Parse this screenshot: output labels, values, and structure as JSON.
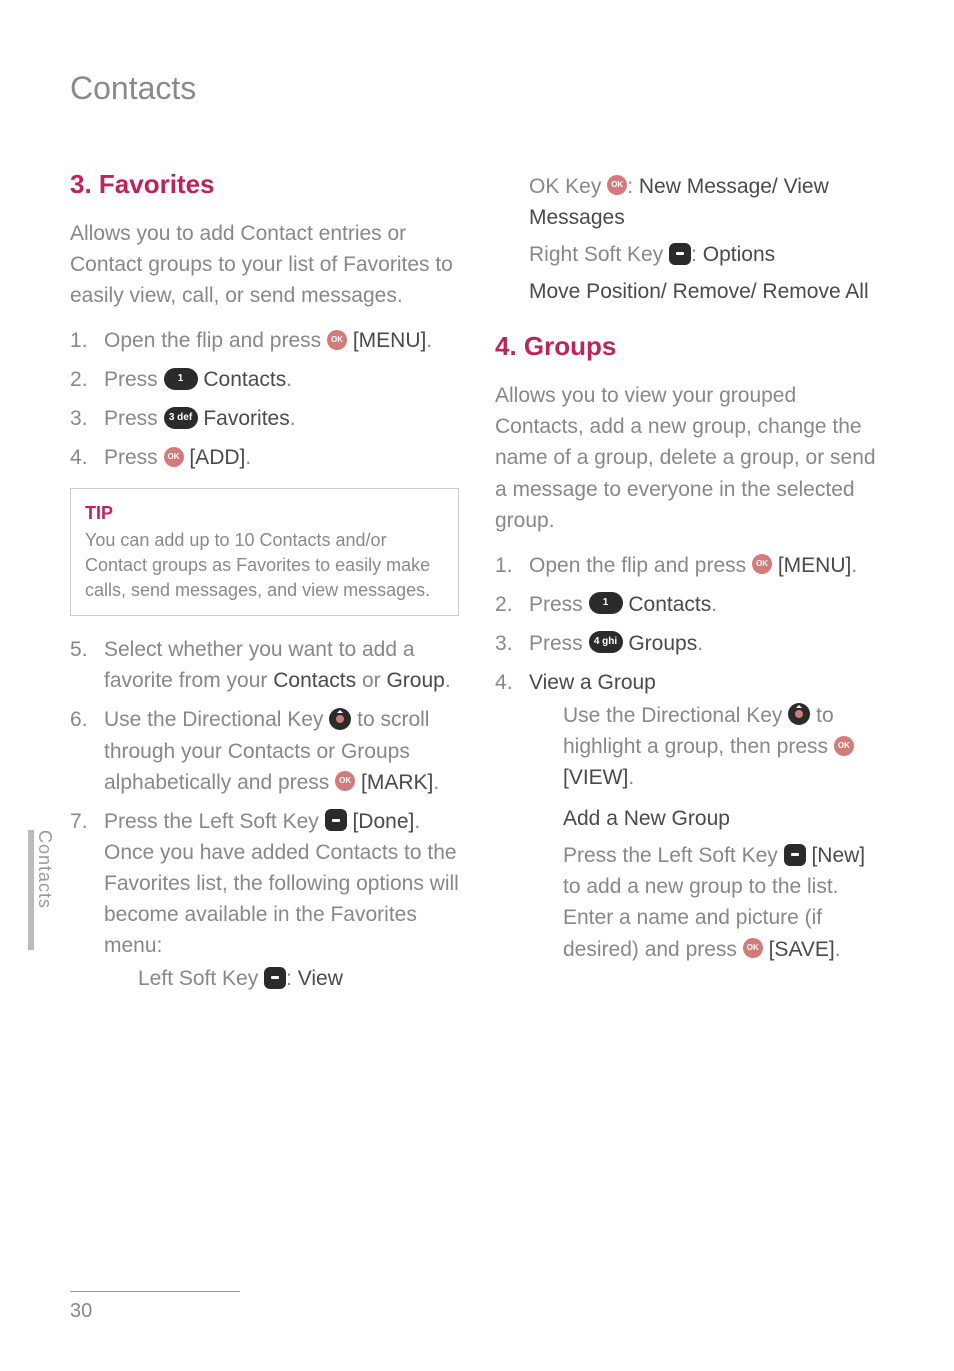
{
  "page_title": "Contacts",
  "sidebar_label": "Contacts",
  "page_number": "30",
  "left": {
    "heading": "3. Favorites",
    "intro": "Allows you to add Contact entries or Contact groups to your list of Favorites to easily view, call, or send messages.",
    "steps": {
      "s1a": "Open the flip and press ",
      "s1b": "[MENU]",
      "s1c": ".",
      "s2a": "Press ",
      "s2key": "1",
      "s2b": " Contacts",
      "s2c": ".",
      "s3a": "Press ",
      "s3key": "3 def",
      "s3b": " Favorites",
      "s3c": ".",
      "s4a": "Press ",
      "s4b": " [ADD]",
      "s4c": "."
    },
    "tip_label": "TIP",
    "tip_body": "You can add up to 10 Contacts and/or Contact groups as Favorites to easily make calls, send messages, and view messages.",
    "steps2": {
      "s5a": "Select whether you want to add a favorite from your ",
      "s5b": "Contacts",
      "s5c": " or ",
      "s5d": "Group",
      "s5e": ".",
      "s6a": "Use the Directional Key ",
      "s6b": " to scroll through your Contacts or Groups alphabetically and press ",
      "s6c": " [MARK]",
      "s6d": ".",
      "s7a": "Press the Left Soft Key ",
      "s7b": " [Done]",
      "s7c": ". Once you have added Contacts to the Favorites list, the following options will become available in the Favorites menu:",
      "s7_line1a": "Left Soft Key ",
      "s7_line1b": ": ",
      "s7_line1c": "View"
    }
  },
  "right": {
    "top": {
      "l1a": "OK Key ",
      "l1b": ": ",
      "l1c": "New Message/ View Messages",
      "l2a": "Right Soft Key ",
      "l2b": ": ",
      "l2c": "Options",
      "l3": "Move Position/ Remove/ Remove All"
    },
    "heading": "4. Groups",
    "intro": "Allows you to view your grouped Contacts, add a new group, change the name of a group, delete a group, or send a message to everyone in the selected group.",
    "steps": {
      "s1a": "Open the flip and press ",
      "s1b": "[MENU]",
      "s1c": ".",
      "s2a": "Press ",
      "s2key": "1",
      "s2b": " Contacts",
      "s2c": ".",
      "s3a": "Press ",
      "s3key": "4 ghi",
      "s3b": " Groups",
      "s3c": ".",
      "s4a": "View a Group",
      "s4_body_a": "Use the Directional Key ",
      "s4_body_b": " to highlight a group, then press ",
      "s4_body_c": " [VIEW]",
      "s4_body_d": ".",
      "addHeading": "Add a New Group",
      "add_a": "Press the Left Soft Key ",
      "add_b": " [New]",
      "add_c": " to add a new group to the list. Enter a name and picture (if desired) and press ",
      "add_d": " [SAVE]",
      "add_e": "."
    }
  }
}
